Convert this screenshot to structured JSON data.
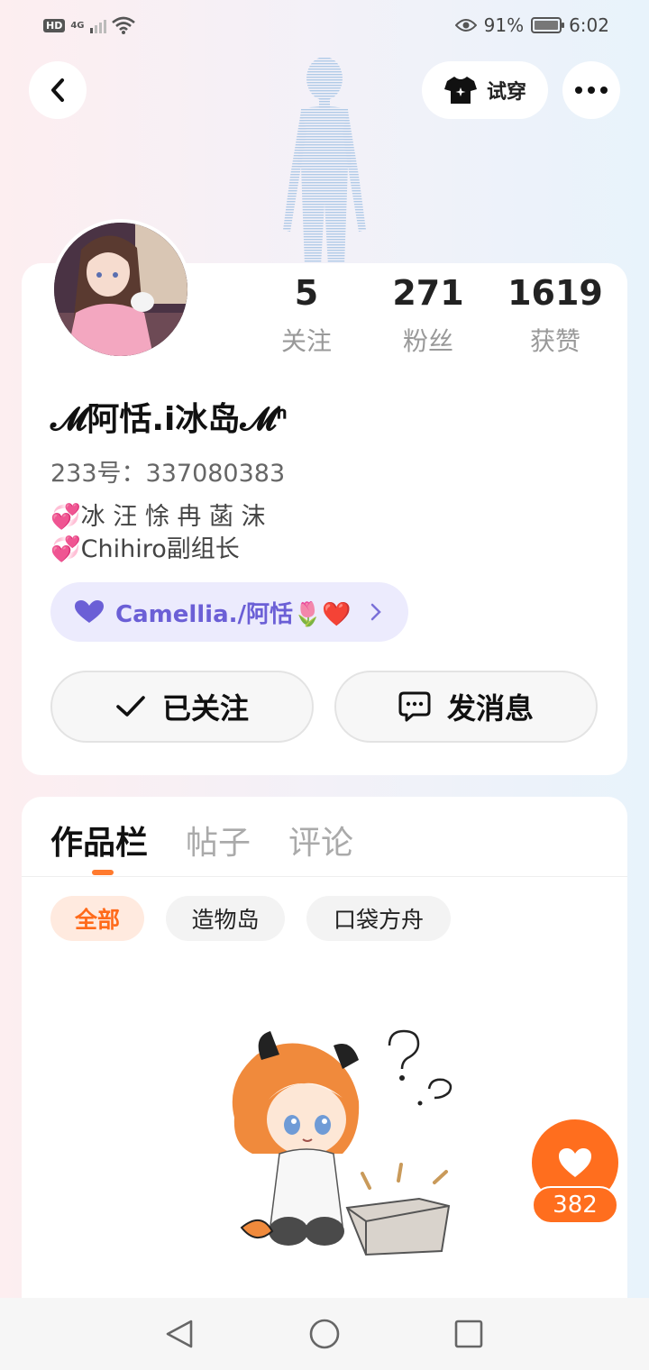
{
  "status_bar": {
    "hd": "HD",
    "network": "4G",
    "battery_percent": "91%",
    "time": "6:02",
    "battery_level": 0.91
  },
  "nav": {
    "back_icon": "chevron-left-icon",
    "try_on_label": "试穿",
    "try_on_icon": "tshirt-icon",
    "more_icon": "ellipsis-icon"
  },
  "profile": {
    "nickname": "𝓜阿恬.i冰岛𝓜ᑋ",
    "uid": "233号：337080383",
    "bio_lines": [
      "冰 汪 悇 冉 菡 沫",
      "Chihiro副组长"
    ],
    "bio_emoji": "💞",
    "guild_label": "Camellia./阿恬🌷❤️",
    "guild_icon": "purple-heart-icon",
    "stats": [
      {
        "value": "5",
        "label": "关注"
      },
      {
        "value": "271",
        "label": "粉丝"
      },
      {
        "value": "1619",
        "label": "获赞"
      }
    ],
    "follow_button": "已关注",
    "message_button": "发消息"
  },
  "content": {
    "tabs": [
      "作品栏",
      "帖子",
      "评论"
    ],
    "active_tab": 0,
    "chips": [
      "全部",
      "造物岛",
      "口袋方舟"
    ],
    "active_chip": 0
  },
  "like": {
    "count": "382"
  },
  "colors": {
    "accent": "#ff6e1e",
    "guild_text": "#6b5fd6",
    "guild_bg": "#ecebfd"
  }
}
